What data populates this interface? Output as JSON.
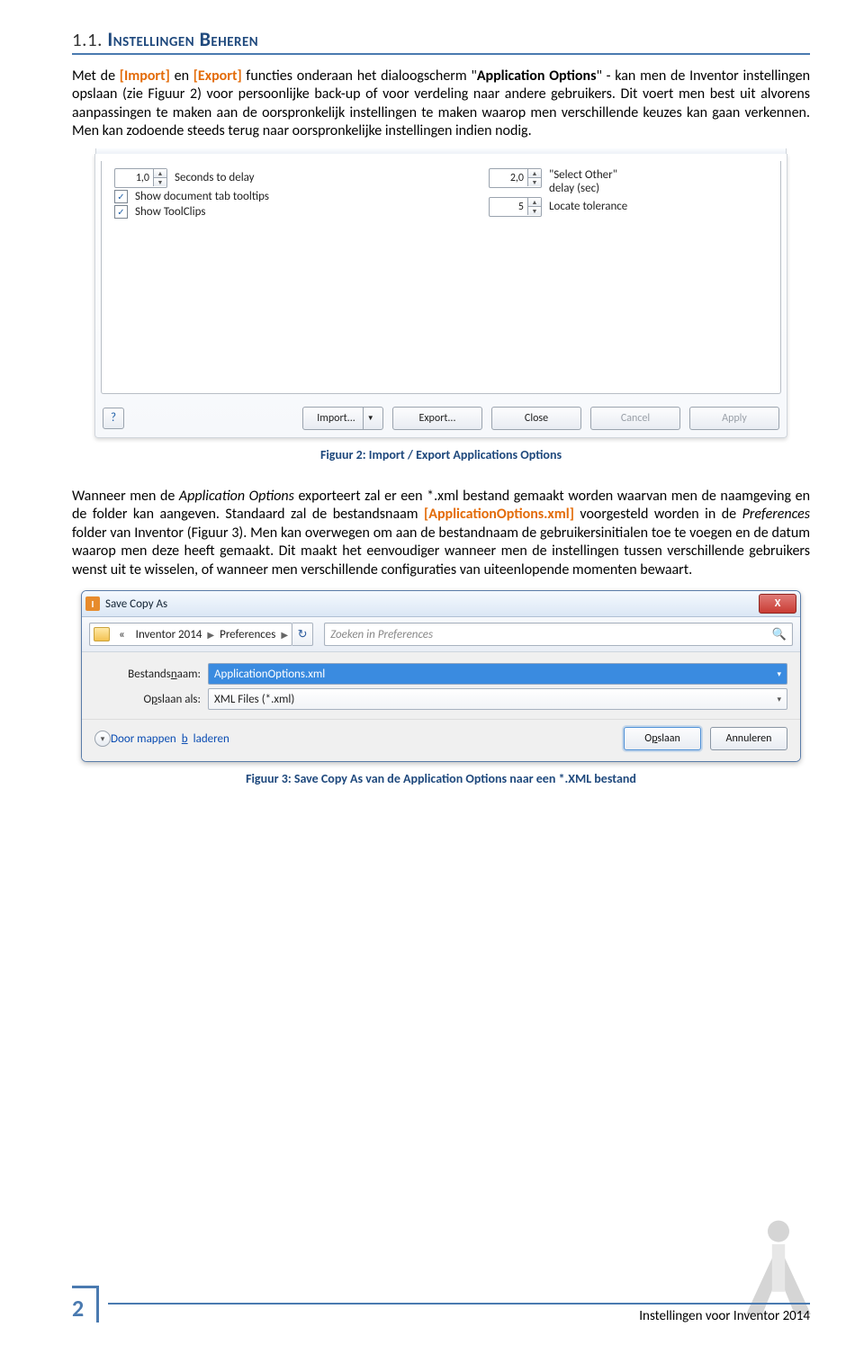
{
  "heading": {
    "num": "1.1.",
    "title": "Instellingen Beheren"
  },
  "para1": {
    "t1": "Met de ",
    "import": "[Import]",
    "t2": " en ",
    "export": "[Export]",
    "t3": " functies onderaan het dialoogscherm \"",
    "dialog": "Application Options",
    "t4": "\" - kan men de Inventor instellingen opslaan (zie Figuur 2) voor persoonlijke back-up of voor verdeling naar andere gebruikers. Dit voert men best uit alvorens aanpassingen te maken aan de oorspronkelijk instellingen te maken waarop men verschillende keuzes kan gaan verkennen. Men kan zodoende steeds terug naar oorspronkelijke instellingen indien nodig."
  },
  "fig1": {
    "spinner1": "1,0",
    "label1": "Seconds to delay",
    "cb1": "Show document tab tooltips",
    "cb2": "Show ToolClips",
    "spinner2": "2,0",
    "label2a": "\"Select Other\"",
    "label2b": "delay (sec)",
    "spinner3": "5",
    "label3": "Locate tolerance",
    "btn_import": "Import...",
    "btn_export": "Export...",
    "btn_close": "Close",
    "btn_cancel": "Cancel",
    "btn_apply": "Apply",
    "caption": "Figuur 2: Import / Export Applications Options"
  },
  "para2": {
    "t1": "Wanneer men de ",
    "app": "Application Options",
    "t2": " exporteert zal er een *.xml bestand gemaakt worden waarvan men de naamgeving en de folder kan aangeven. Standaard zal de bestandsnaam ",
    "file": "[ApplicationOptions.xml]",
    "t3": " voorgesteld worden in de ",
    "pref": "Preferences",
    "t4": " folder van Inventor (Figuur 3). Men kan overwegen om aan de bestandnaam de gebruikersinitialen toe te voegen en de datum waarop men deze heeft gemaakt. Dit maakt het eenvoudiger wanneer men de instellingen tussen verschillende gebruikers wenst uit te wisselen, of wanneer men verschillende configuraties van uiteenlopende momenten bewaart."
  },
  "fig2": {
    "title": "Save Copy As",
    "crumb_prefix": "«",
    "crumb1": "Inventor 2014",
    "crumb2": "Preferences",
    "search_placeholder": "Zoeken in Preferences",
    "label_name": "Bestandsnaam:",
    "value_name": "ApplicationOptions.xml",
    "label_type": "Opslaan als:",
    "value_type": "XML Files (*.xml)",
    "browse": "Door mappen bladeren",
    "btn_save": "Opslaan",
    "btn_cancel": "Annuleren",
    "caption": "Figuur 3: Save Copy As van de Application Options naar een *.XML bestand"
  },
  "footer": {
    "page": "2",
    "text": "Instellingen voor Inventor 2014"
  }
}
